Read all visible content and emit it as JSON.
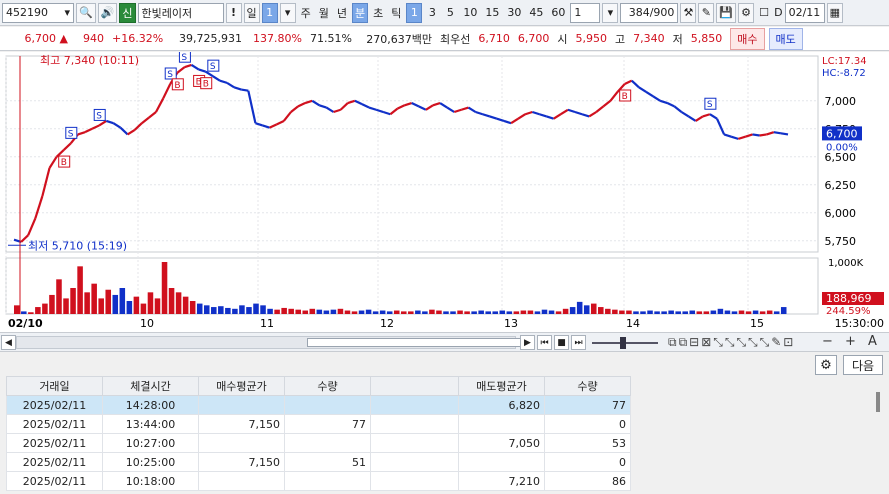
{
  "toolbar": {
    "code": "452190",
    "badge": "신",
    "name": "한빛레이저",
    "warn": "!",
    "period_label": "일",
    "period_value": "1",
    "periods": [
      "주",
      "월",
      "년",
      "분",
      "초",
      "틱"
    ],
    "intervals": [
      "1",
      "3",
      "5",
      "10",
      "15",
      "30",
      "45",
      "60"
    ],
    "interval_value": "1",
    "count": "384",
    "count_total": "/900",
    "date": "02/11",
    "check_label": "D"
  },
  "quote": {
    "price": "6,700 ▲",
    "change": "940",
    "change_pct": "+16.32%",
    "volume": "39,725,931",
    "vol_ratio": "137.80%",
    "turnover": "71.51%",
    "amount": "270,637백만",
    "best_ask_label": "최우선",
    "best_ask": "6,710",
    "best_bid": "6,700",
    "open_label": "시",
    "open": "5,950",
    "high_label": "고",
    "high": "7,340",
    "low_label": "저",
    "low": "5,850",
    "buy_label": "매수",
    "sell_label": "매도"
  },
  "chart_data": {
    "type": "line",
    "title": "",
    "high_annotation": "최고 7,340 (10:11)",
    "low_annotation": "최저 5,710 (15:19)",
    "lc_label": "LC:17.34",
    "hc_label": "HC:-8.72",
    "current_price_label": "6,700",
    "current_pct_label": "0.00%",
    "y_ticks": [
      "7,000",
      "6,750",
      "6,500",
      "6,250",
      "6,000",
      "5,750"
    ],
    "y_tick_values": [
      7000,
      6750,
      6500,
      6250,
      6000,
      5750
    ],
    "ylim": [
      5650,
      7400
    ],
    "x_labels": [
      "02/10",
      "10",
      "11",
      "12",
      "13",
      "14",
      "15",
      "15:30:00"
    ],
    "price_series": [
      5760,
      5740,
      5800,
      5950,
      6150,
      6400,
      6500,
      6560,
      6620,
      6700,
      6720,
      6750,
      6780,
      6820,
      6800,
      6760,
      6700,
      6740,
      6800,
      6850,
      6900,
      7020,
      7150,
      7250,
      7300,
      7320,
      7280,
      7260,
      7220,
      7180,
      7160,
      7120,
      7100,
      7090,
      6800,
      6780,
      6760,
      6790,
      6820,
      6900,
      6950,
      6980,
      7000,
      6960,
      6940,
      6900,
      6920,
      6980,
      7000,
      6970,
      6940,
      6920,
      6900,
      6880,
      6930,
      6960,
      6980,
      6950,
      6920,
      6960,
      6980,
      6940,
      6900,
      6920,
      6940,
      6900,
      6880,
      6860,
      6840,
      6820,
      6800,
      6840,
      6880,
      6900,
      6880,
      6860,
      6840,
      6880,
      6920,
      6900,
      6880,
      6860,
      6900,
      6950,
      7000,
      7080,
      7150,
      7180,
      7120,
      7080,
      7040,
      7000,
      6980,
      6950,
      6900,
      6860,
      6820,
      6860,
      6880,
      6840,
      6700,
      6680,
      6660,
      6680,
      6700,
      6690,
      6700,
      6720,
      6710,
      6700
    ],
    "volume_max_label": "1,000K",
    "volume_value_label": "188,969",
    "volume_pct_label": "244.59%",
    "volume_series": [
      10,
      3,
      2,
      8,
      12,
      22,
      40,
      18,
      30,
      55,
      25,
      35,
      18,
      28,
      22,
      30,
      15,
      20,
      12,
      25,
      18,
      60,
      30,
      25,
      20,
      15,
      12,
      10,
      8,
      9,
      7,
      6,
      10,
      8,
      12,
      10,
      6,
      5,
      7,
      6,
      5,
      4,
      6,
      5,
      4,
      5,
      6,
      4,
      3,
      4,
      5,
      3,
      4,
      3,
      4,
      3,
      3,
      4,
      3,
      5,
      4,
      3,
      3,
      4,
      3,
      3,
      4,
      3,
      3,
      4,
      3,
      3,
      4,
      4,
      3,
      5,
      4,
      3,
      6,
      8,
      14,
      10,
      12,
      8,
      6,
      5,
      4,
      4,
      3,
      3,
      4,
      3,
      3,
      4,
      3,
      3,
      4,
      3,
      3,
      4,
      6,
      4,
      3,
      4,
      3,
      4,
      3,
      4,
      3,
      8
    ],
    "markers": [
      "B",
      "S",
      "S",
      "B",
      "S",
      "B",
      "S",
      "S",
      "B",
      "B",
      "S"
    ]
  },
  "nav": {
    "next_label": "다음"
  },
  "table": {
    "headers": [
      "거래일",
      "체결시간",
      "매수평균가",
      "수량",
      "",
      "매도평균가",
      "수량"
    ],
    "rows": [
      [
        "2025/02/11",
        "14:28:00",
        "",
        "",
        "",
        "6,820",
        "77"
      ],
      [
        "2025/02/11",
        "13:44:00",
        "7,150",
        "77",
        "",
        "",
        "0"
      ],
      [
        "2025/02/11",
        "10:27:00",
        "",
        "",
        "",
        "7,050",
        "53"
      ],
      [
        "2025/02/11",
        "10:25:00",
        "7,150",
        "51",
        "",
        "",
        "0"
      ],
      [
        "2025/02/11",
        "10:18:00",
        "",
        "",
        "",
        "7,210",
        "86"
      ]
    ]
  },
  "colors": {
    "up": "#d0101e",
    "down": "#1030c8",
    "selected": "#7aa7e8"
  }
}
